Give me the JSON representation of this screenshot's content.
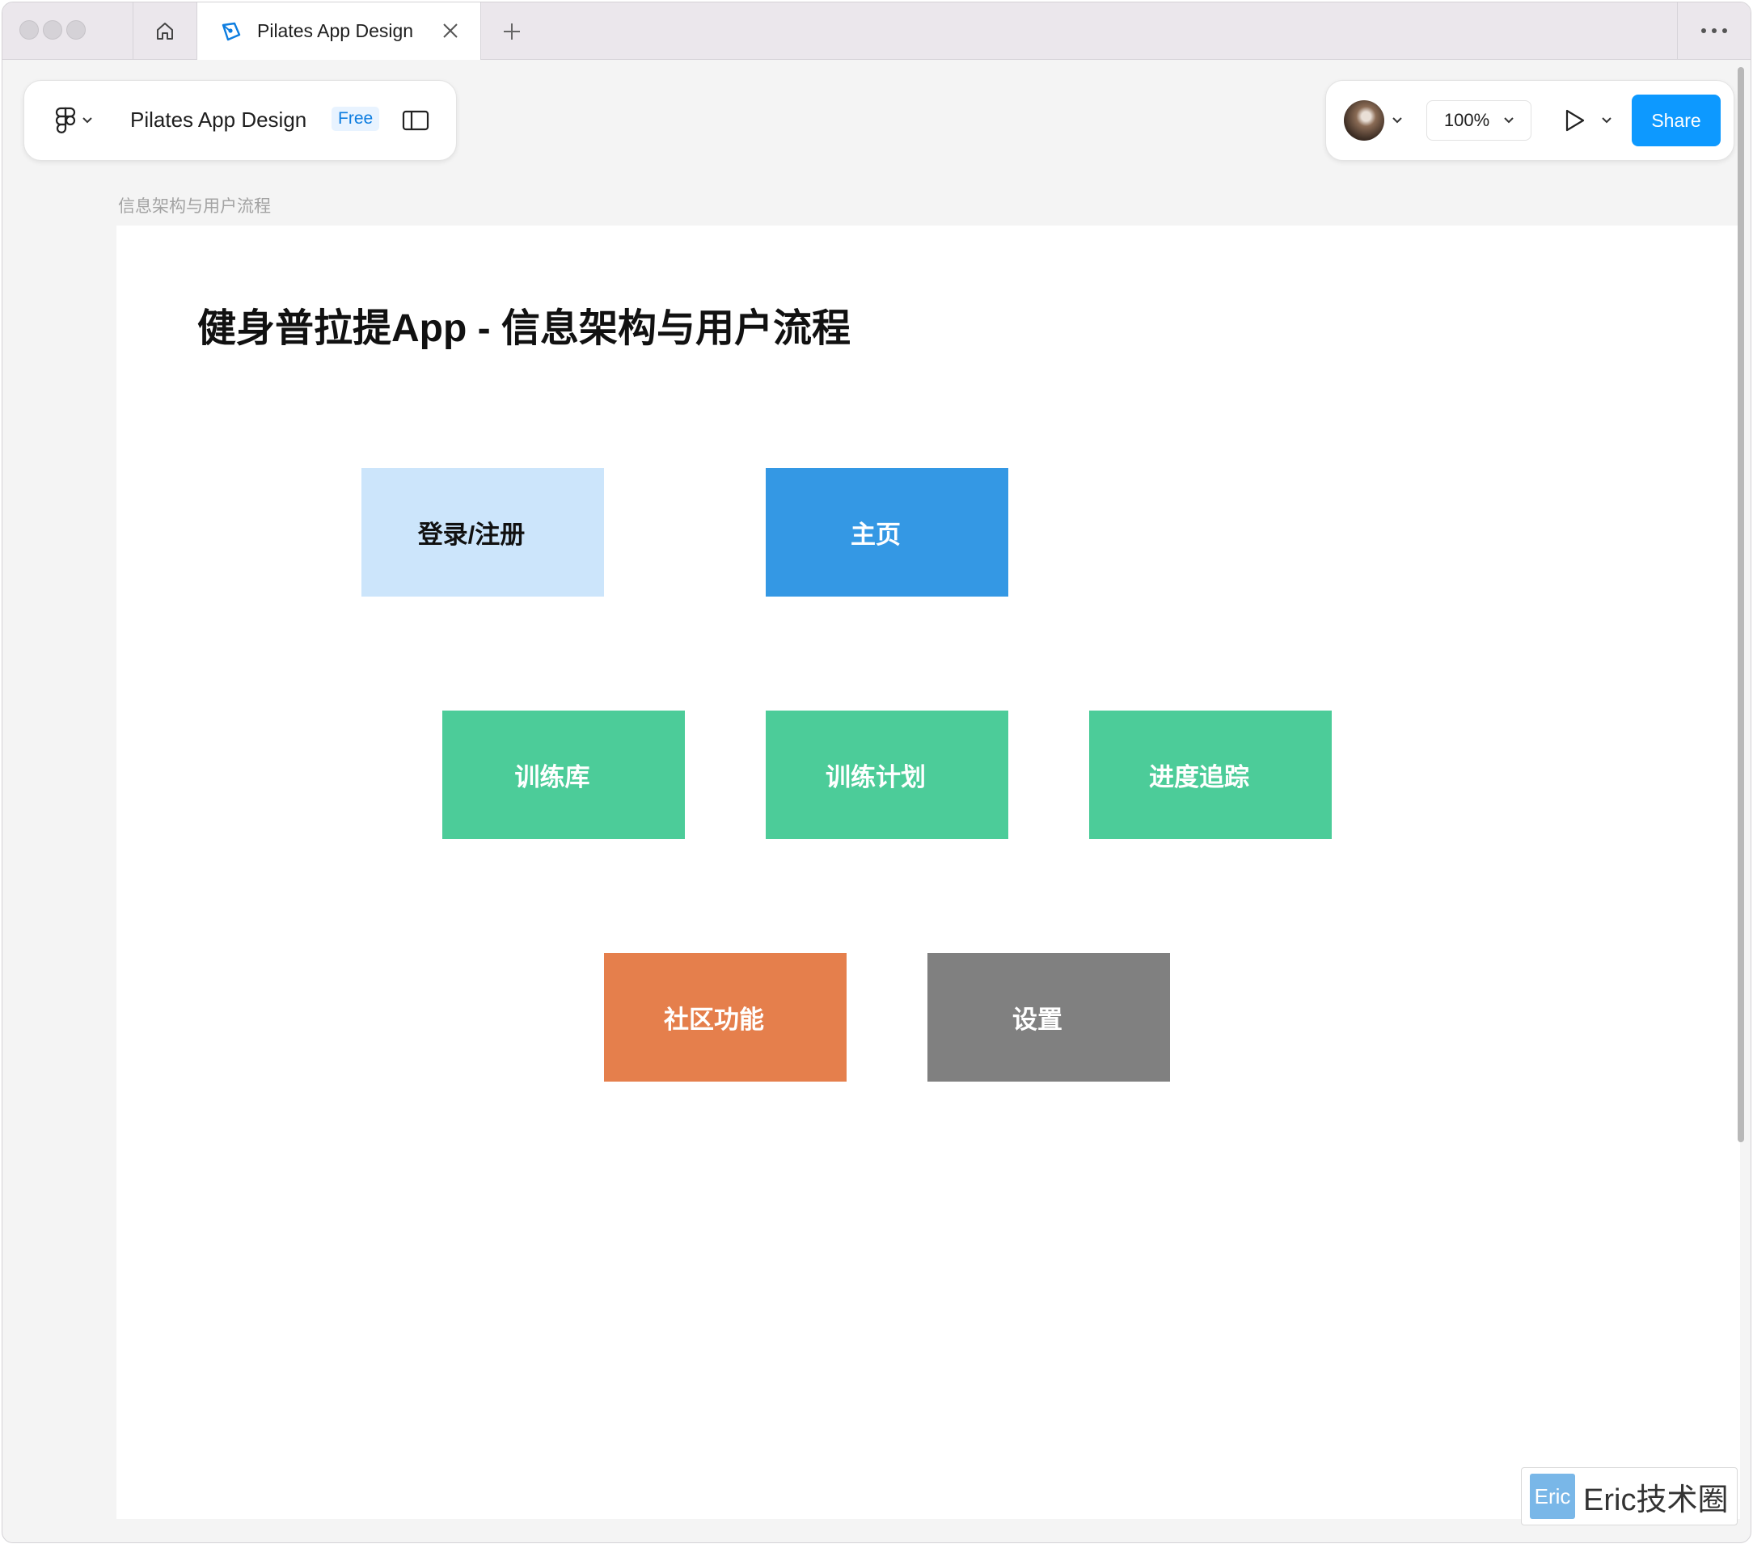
{
  "tabbar": {
    "tab_title": "Pilates App Design"
  },
  "toolbar": {
    "file_name": "Pilates App Design",
    "plan_badge": "Free",
    "zoom": "100%",
    "share_label": "Share"
  },
  "canvas": {
    "frame_label": "信息架构与用户流程",
    "title": "健身普拉提App - 信息架构与用户流程",
    "nodes": [
      {
        "label": "登录/注册",
        "color": "#cce5fb",
        "text_color": "#111111"
      },
      {
        "label": "主页",
        "color": "#3498e4",
        "text_color": "#ffffff"
      },
      {
        "label": "训练库",
        "color": "#4ccc99",
        "text_color": "#ffffff"
      },
      {
        "label": "训练计划",
        "color": "#4ccc99",
        "text_color": "#ffffff"
      },
      {
        "label": "进度追踪",
        "color": "#4ccc99",
        "text_color": "#ffffff"
      },
      {
        "label": "社区功能",
        "color": "#e57f4c",
        "text_color": "#ffffff"
      },
      {
        "label": "设置",
        "color": "#808080",
        "text_color": "#ffffff"
      }
    ]
  },
  "watermark": {
    "badge": "Eric",
    "text": "Eric技术圈"
  },
  "icons": [
    "home-icon",
    "figma-pen-icon",
    "close-icon",
    "plus-icon",
    "more-icon",
    "figma-logo-icon",
    "chevron-down-icon",
    "sidebar-toggle-icon",
    "play-icon"
  ],
  "colors": {
    "accent": "#0d99ff"
  }
}
